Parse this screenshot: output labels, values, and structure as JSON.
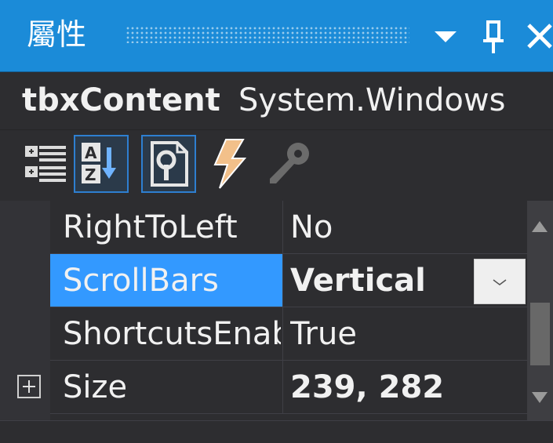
{
  "panel": {
    "title": "屬性"
  },
  "object": {
    "name": "tbxContent",
    "type": "System.Windows"
  },
  "toolbar": {
    "buttons": [
      {
        "name": "categorized",
        "icon": "categorized-icon",
        "active": false
      },
      {
        "name": "alphabetical",
        "icon": "sort-az-icon",
        "active": true
      },
      {
        "name": "properties",
        "icon": "property-page-icon",
        "active": true
      },
      {
        "name": "events",
        "icon": "lightning-icon",
        "active": false
      },
      {
        "name": "property-pages",
        "icon": "wrench-key-icon",
        "active": false
      }
    ]
  },
  "properties": [
    {
      "name": "RightToLeft",
      "value": "No",
      "selected": false,
      "bold": false
    },
    {
      "name": "ScrollBars",
      "value": "Vertical",
      "selected": true,
      "bold": true
    },
    {
      "name": "ShortcutsEnabled",
      "value": "True",
      "selected": false,
      "bold": false
    },
    {
      "name": "Size",
      "value": "239, 282",
      "selected": false,
      "bold": true,
      "expandable": true
    }
  ],
  "colors": {
    "titlebar": "#1b8bd8",
    "background": "#2d2d30",
    "selection": "#3399ff",
    "text": "#f1f1f1"
  }
}
